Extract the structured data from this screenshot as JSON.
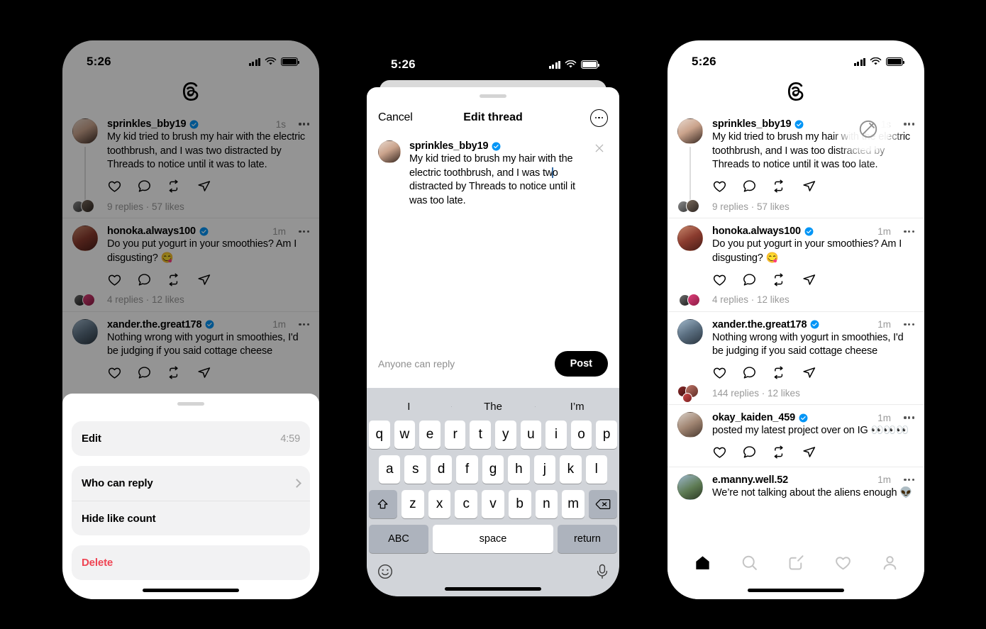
{
  "status_bar": {
    "time": "5:26"
  },
  "app": {
    "name": "Threads",
    "logo_icon": "threads-logo-icon"
  },
  "phone1": {
    "label": "threads-feed-with-action-sheet",
    "posts": [
      {
        "username": "sprinkles_bby19",
        "verified": true,
        "time": "1s",
        "text": "My kid tried to brush my hair with the electric toothbrush, and I was two distracted by Threads to notice until it was to late.",
        "meta": "9 replies · 57 likes"
      },
      {
        "username": "honoka.always100",
        "verified": true,
        "time": "1m",
        "text": "Do you put yogurt in your smoothies? Am I disgusting? 😋",
        "meta": "4 replies · 12 likes"
      },
      {
        "username": "xander.the.great178",
        "verified": true,
        "time": "1m",
        "text": "Nothing wrong with yogurt in smoothies, I'd be judging if you said cottage cheese",
        "meta": ""
      }
    ],
    "action_sheet": {
      "groups": [
        [
          {
            "label": "Edit",
            "trailing": "4:59",
            "style": "default",
            "chevron": false
          }
        ],
        [
          {
            "label": "Who can reply",
            "trailing": "",
            "style": "default",
            "chevron": true
          },
          {
            "label": "Hide like count",
            "trailing": "",
            "style": "default",
            "chevron": false
          }
        ],
        [
          {
            "label": "Delete",
            "trailing": "",
            "style": "destructive",
            "chevron": false
          }
        ]
      ]
    }
  },
  "phone2": {
    "label": "edit-thread-composer",
    "nav": {
      "cancel": "Cancel",
      "title": "Edit thread",
      "more_icon": "more-circle-icon"
    },
    "composer": {
      "username": "sprinkles_bby19",
      "verified": true,
      "text_before_caret": "My kid tried to brush my hair with the electric toothbrush, and I was tw",
      "text_after_caret": "o distracted by Threads to notice until it was too late.",
      "close_icon": "close-icon"
    },
    "bar": {
      "reply_setting": "Anyone can reply",
      "post_label": "Post"
    },
    "keyboard": {
      "predictions": [
        "I",
        "The",
        "I’m"
      ],
      "row1": [
        "q",
        "w",
        "e",
        "r",
        "t",
        "y",
        "u",
        "i",
        "o",
        "p"
      ],
      "row2": [
        "a",
        "s",
        "d",
        "f",
        "g",
        "h",
        "j",
        "k",
        "l"
      ],
      "row3": [
        "z",
        "x",
        "c",
        "v",
        "b",
        "n",
        "m"
      ],
      "shift_icon": "shift-icon",
      "backspace_icon": "backspace-icon",
      "abc_label": "ABC",
      "space_label": "space",
      "return_label": "return",
      "emoji_icon": "emoji-icon",
      "mic_icon": "microphone-icon"
    }
  },
  "phone3": {
    "label": "threads-feed-edited",
    "edited_badge_icon": "edited-indicator-icon",
    "posts": [
      {
        "username": "sprinkles_bby19",
        "verified": true,
        "time": "1s",
        "text": "My kid tried to brush my hair with the electric toothbrush, and I was too distracted by Threads to notice until it was too late.",
        "meta": "9 replies · 57 likes"
      },
      {
        "username": "honoka.always100",
        "verified": true,
        "time": "1m",
        "text": "Do you put yogurt in your smoothies? Am I disgusting? 😋",
        "meta": "4 replies · 12 likes"
      },
      {
        "username": "xander.the.great178",
        "verified": true,
        "time": "1m",
        "text": "Nothing wrong with yogurt in smoothies, I'd be judging if you said cottage cheese",
        "meta": "144 replies · 12 likes"
      },
      {
        "username": "okay_kaiden_459",
        "verified": true,
        "time": "1m",
        "text": "posted my latest project over on IG 👀👀👀",
        "meta": ""
      },
      {
        "username": "e.manny.well.52",
        "verified": false,
        "time": "1m",
        "text": "We’re not talking about the aliens enough 👽",
        "meta": ""
      }
    ],
    "tabbar": [
      {
        "name": "home",
        "icon": "home-icon",
        "active": true
      },
      {
        "name": "search",
        "icon": "search-icon",
        "active": false
      },
      {
        "name": "compose",
        "icon": "compose-icon",
        "active": false
      },
      {
        "name": "activity",
        "icon": "heart-icon",
        "active": false
      },
      {
        "name": "profile",
        "icon": "profile-icon",
        "active": false
      }
    ]
  },
  "colors": {
    "verified_blue": "#0095F6",
    "destructive_red": "#EF4453",
    "accent_black": "#000000"
  }
}
